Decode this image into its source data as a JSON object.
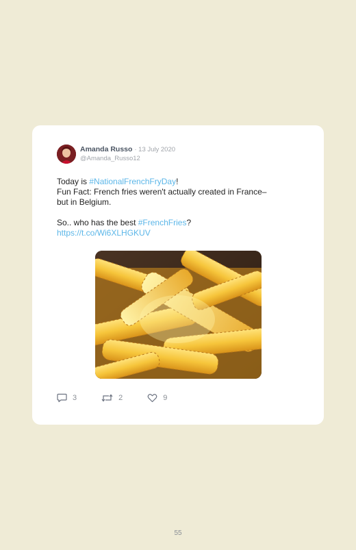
{
  "tweet": {
    "author_name": "Amanda Russo",
    "date": "· 13 July 2020",
    "handle": "@Amanda_Russo12",
    "line1_prefix": "Today is ",
    "line1_hashtag": "#NationalFrenchFryDay",
    "line1_suffix": "!",
    "line2": "Fun Fact: French fries weren't actually created in France–",
    "line3": "but in Belgium.",
    "line4_prefix": "So.. who has the best ",
    "line4_hashtag": "#FrenchFries",
    "line4_suffix": "?",
    "url": "https://t.co/Wi6XLHGKUV",
    "link_color": "#5bb6e8",
    "image_subject": "crinkle-cut french fries"
  },
  "actions": {
    "replies": "3",
    "retweets": "2",
    "likes": "9",
    "reply_icon": "comment-icon",
    "retweet_icon": "retweet-icon",
    "like_icon": "heart-icon"
  },
  "page": {
    "number": "55"
  }
}
